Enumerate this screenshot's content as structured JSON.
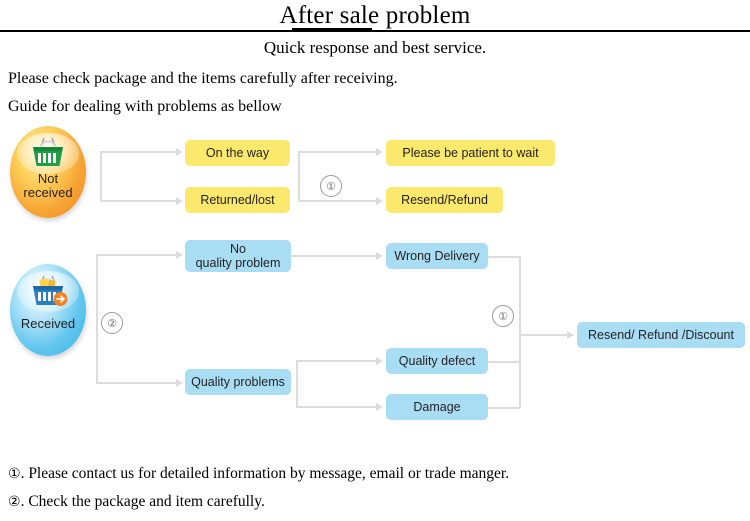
{
  "header": {
    "title": "After sale problem",
    "subtitle": "Quick response and best service.",
    "lead1": "Please check package and the items carefully after receiving.",
    "lead2": "Guide for dealing with problems as bellow"
  },
  "bubbles": {
    "not_received": {
      "label": "Not\nreceived",
      "line1": "Not",
      "line2": "received",
      "icon": "shopping-basket-icon",
      "color": "#f2952b"
    },
    "received": {
      "label": "Received",
      "icon": "shopping-basket-check-icon",
      "color": "#3cb6e9"
    }
  },
  "flow": {
    "yellow_color": "#fae96d",
    "blue_color": "#a9ddf4",
    "not_received_branch": [
      {
        "label": "On the way"
      },
      {
        "label": "Returned/lost"
      }
    ],
    "not_received_outcomes": [
      {
        "label": "Please be patient to wait"
      },
      {
        "label": "Resend/Refund"
      }
    ],
    "received_branch": [
      {
        "line1": "No",
        "line2": "quality problem"
      },
      {
        "label": "Quality problems"
      }
    ],
    "received_sub": [
      {
        "label": "Wrong Delivery"
      },
      {
        "label": "Quality defect"
      },
      {
        "label": "Damage"
      }
    ],
    "received_outcome": {
      "label": "Resend/ Refund /Discount"
    },
    "markers": {
      "marker_a": "①",
      "marker_b": "②",
      "marker_c": "①"
    }
  },
  "notes": [
    {
      "marker": "①",
      "text": ". Please contact us for detailed information by message, email or trade manger."
    },
    {
      "marker": "②",
      "text": ". Check the package and item carefully."
    }
  ]
}
